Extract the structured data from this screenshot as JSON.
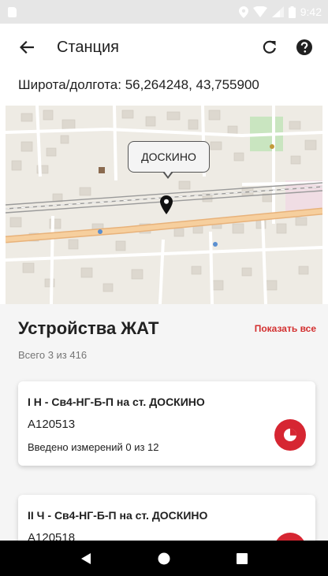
{
  "status_bar": {
    "time": "9:42"
  },
  "app_bar": {
    "title": "Станция"
  },
  "location": {
    "coords_text": "Широта/долгота: 56,264248, 43,755900"
  },
  "map": {
    "callout_label": "ДОСКИНО"
  },
  "devices": {
    "title": "Устройства ЖАТ",
    "show_all": "Показать все",
    "summary": "Всего 3 из 416",
    "items": [
      {
        "title": "I Н - Св4-НГ-Б-П на ст. ДОСКИНО",
        "code": "А120513",
        "measurements": "Введено измерений 0 из 12"
      },
      {
        "title": "II Ч - Св4-НГ-Б-П на ст. ДОСКИНО",
        "code": "А120518"
      }
    ]
  },
  "icons": {
    "back": "arrow-left-icon",
    "refresh": "refresh-icon",
    "help": "help-circle-icon",
    "device_action": "pie-chart-icon",
    "nav_back": "triangle-back-icon",
    "nav_home": "circle-home-icon",
    "nav_recents": "square-recents-icon"
  },
  "colors": {
    "accent": "#d62632",
    "link": "#d32f2f",
    "status_bar": "#e6e6e6"
  }
}
